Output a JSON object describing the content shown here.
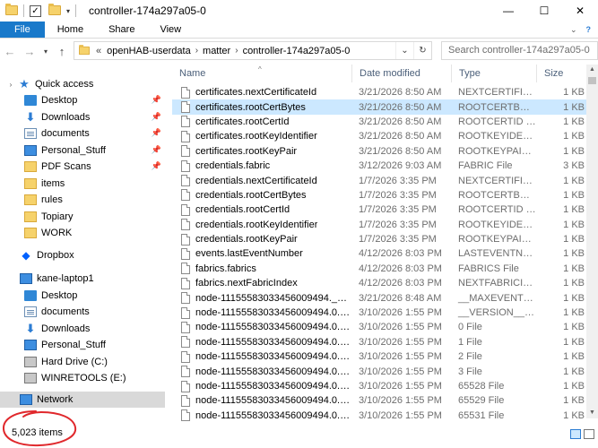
{
  "window": {
    "title": "controller-174a297a05-0",
    "minimize": "—",
    "maximize": "☐",
    "close": "✕"
  },
  "ribbon": {
    "tabs": [
      "File",
      "Home",
      "Share",
      "View"
    ]
  },
  "address": {
    "breadcrumb": [
      "openHAB-userdata",
      "matter",
      "controller-174a297a05-0"
    ],
    "overflow": "«",
    "search_placeholder": "Search controller-174a297a05-0"
  },
  "nav": {
    "quick_access": "Quick access",
    "items": [
      {
        "label": "Desktop",
        "icon": "desktop-icon",
        "pinned": true
      },
      {
        "label": "Downloads",
        "icon": "downloads-icon",
        "pinned": true
      },
      {
        "label": "documents",
        "icon": "documents-icon",
        "pinned": true
      },
      {
        "label": "Personal_Stuff",
        "icon": "monitor-icon",
        "pinned": true
      },
      {
        "label": "PDF Scans",
        "icon": "folder-icon",
        "pinned": true
      },
      {
        "label": "items",
        "icon": "folder-icon",
        "pinned": false
      },
      {
        "label": "rules",
        "icon": "folder-icon",
        "pinned": false
      },
      {
        "label": "Topiary",
        "icon": "folder-icon",
        "pinned": false
      },
      {
        "label": "WORK",
        "icon": "folder-icon",
        "pinned": false
      }
    ],
    "dropbox": "Dropbox",
    "this_pc": "kane-laptop1",
    "pc_items": [
      {
        "label": "Desktop",
        "icon": "desktop-icon"
      },
      {
        "label": "documents",
        "icon": "documents-icon"
      },
      {
        "label": "Downloads",
        "icon": "downloads-icon"
      },
      {
        "label": "Personal_Stuff",
        "icon": "monitor-icon"
      },
      {
        "label": "Hard Drive (C:)",
        "icon": "drive-icon"
      },
      {
        "label": "WINRETOOLS (E:)",
        "icon": "drive-icon"
      }
    ],
    "network": "Network"
  },
  "columns": {
    "name": "Name",
    "date": "Date modified",
    "type": "Type",
    "size": "Size"
  },
  "files": [
    {
      "name": "certificates.nextCertificateId",
      "date": "3/21/2026 8:50 AM",
      "type": "NEXTCERTIFICATEID ...",
      "size": "1 KB"
    },
    {
      "name": "certificates.rootCertBytes",
      "date": "3/21/2026 8:50 AM",
      "type": "ROOTCERTBYTES F...",
      "size": "1 KB",
      "selected": true
    },
    {
      "name": "certificates.rootCertId",
      "date": "3/21/2026 8:50 AM",
      "type": "ROOTCERTID File",
      "size": "1 KB"
    },
    {
      "name": "certificates.rootKeyIdentifier",
      "date": "3/21/2026 8:50 AM",
      "type": "ROOTKEYIDENTIFI...",
      "size": "1 KB"
    },
    {
      "name": "certificates.rootKeyPair",
      "date": "3/21/2026 8:50 AM",
      "type": "ROOTKEYPAIR File",
      "size": "1 KB"
    },
    {
      "name": "credentials.fabric",
      "date": "3/12/2026 9:03 AM",
      "type": "FABRIC File",
      "size": "3 KB"
    },
    {
      "name": "credentials.nextCertificateId",
      "date": "1/7/2026 3:35 PM",
      "type": "NEXTCERTIFICATEID ...",
      "size": "1 KB"
    },
    {
      "name": "credentials.rootCertBytes",
      "date": "1/7/2026 3:35 PM",
      "type": "ROOTCERTBYTES F...",
      "size": "1 KB"
    },
    {
      "name": "credentials.rootCertId",
      "date": "1/7/2026 3:35 PM",
      "type": "ROOTCERTID File",
      "size": "1 KB"
    },
    {
      "name": "credentials.rootKeyIdentifier",
      "date": "1/7/2026 3:35 PM",
      "type": "ROOTKEYIDENTIFI...",
      "size": "1 KB"
    },
    {
      "name": "credentials.rootKeyPair",
      "date": "1/7/2026 3:35 PM",
      "type": "ROOTKEYPAIR File",
      "size": "1 KB"
    },
    {
      "name": "events.lastEventNumber",
      "date": "4/12/2026 8:03 PM",
      "type": "LASTEVENTNUMB...",
      "size": "1 KB"
    },
    {
      "name": "fabrics.fabrics",
      "date": "4/12/2026 8:03 PM",
      "type": "FABRICS File",
      "size": "1 KB"
    },
    {
      "name": "fabrics.nextFabricIndex",
      "date": "4/12/2026 8:03 PM",
      "type": "NEXTFABRICINDE...",
      "size": "1 KB"
    },
    {
      "name": "node-1115558303345600949​4.__maxEvent...",
      "date": "3/21/2026 8:48 AM",
      "type": "__MAXEVENTNU...",
      "size": "1 KB"
    },
    {
      "name": "node-1115558303345600949​4.0.29.__versi...",
      "date": "3/10/2026 1:55 PM",
      "type": "__VERSION__ File",
      "size": "1 KB"
    },
    {
      "name": "node-1115558303345600949​4.0.29.0",
      "date": "3/10/2026 1:55 PM",
      "type": "0 File",
      "size": "1 KB"
    },
    {
      "name": "node-1115558303345600949​4.0.29.1",
      "date": "3/10/2026 1:55 PM",
      "type": "1 File",
      "size": "1 KB"
    },
    {
      "name": "node-1115558303345600949​4.0.29.2",
      "date": "3/10/2026 1:55 PM",
      "type": "2 File",
      "size": "1 KB"
    },
    {
      "name": "node-1115558303345600949​4.0.29.3",
      "date": "3/10/2026 1:55 PM",
      "type": "3 File",
      "size": "1 KB"
    },
    {
      "name": "node-1115558303345600949​4.0.29.65528",
      "date": "3/10/2026 1:55 PM",
      "type": "65528 File",
      "size": "1 KB"
    },
    {
      "name": "node-1115558303345600949​4.0.29.65529",
      "date": "3/10/2026 1:55 PM",
      "type": "65529 File",
      "size": "1 KB"
    },
    {
      "name": "node-1115558303345600949​4.0.29.65531",
      "date": "3/10/2026 1:55 PM",
      "type": "65531 File",
      "size": "1 KB"
    }
  ],
  "status": {
    "count": "5,023 items"
  },
  "colors": {
    "accent": "#1979ca",
    "selection": "#cce8ff",
    "annotation": "#e0282c"
  }
}
